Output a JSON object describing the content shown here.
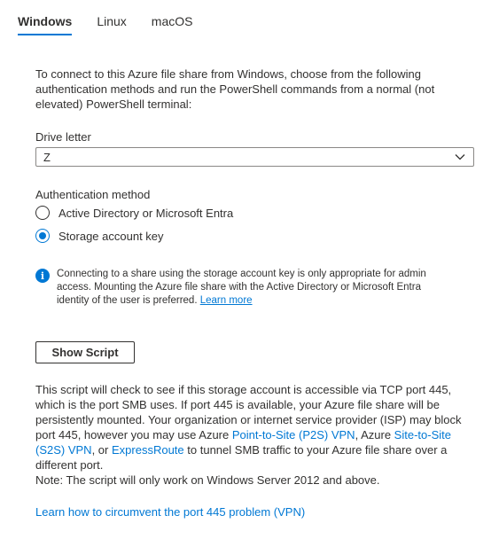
{
  "tabs": [
    {
      "label": "Windows",
      "active": true
    },
    {
      "label": "Linux",
      "active": false
    },
    {
      "label": "macOS",
      "active": false
    }
  ],
  "intro": "To connect to this Azure file share from Windows, choose from the following authentication methods and run the PowerShell commands from a normal (not elevated) PowerShell terminal:",
  "drive_letter": {
    "label": "Drive letter",
    "value": "Z"
  },
  "auth": {
    "label": "Authentication method",
    "options": [
      {
        "label": "Active Directory or Microsoft Entra",
        "selected": false
      },
      {
        "label": "Storage account key",
        "selected": true
      }
    ]
  },
  "info": {
    "icon": "info-icon",
    "text": "Connecting to a share using the storage account key is only appropriate for admin access. Mounting the Azure file share with the Active Directory or Microsoft Entra identity of the user is preferred.",
    "link": "Learn more"
  },
  "show_script_label": "Show Script",
  "script_desc": {
    "part1": "This script will check to see if this storage account is accessible via TCP port 445, which is the port SMB uses. If port 445 is available, your Azure file share will be persistently mounted. Your organization or internet service provider (ISP) may block port 445, however you may use Azure",
    "link_p2s": "Point-to-Site (P2S) VPN",
    "part2": ", Azure",
    "link_s2s": "Site-to-Site (S2S) VPN",
    "part3": ", or",
    "link_express": "ExpressRoute",
    "part4": "to tunnel SMB traffic to your Azure file share over a different port."
  },
  "note": "Note: The script will only work on Windows Server 2012 and above.",
  "learn_link": "Learn how to circumvent the port 445 problem (VPN)",
  "colors": {
    "accent": "#0078d4",
    "text": "#323130",
    "border": "#8a8886"
  }
}
